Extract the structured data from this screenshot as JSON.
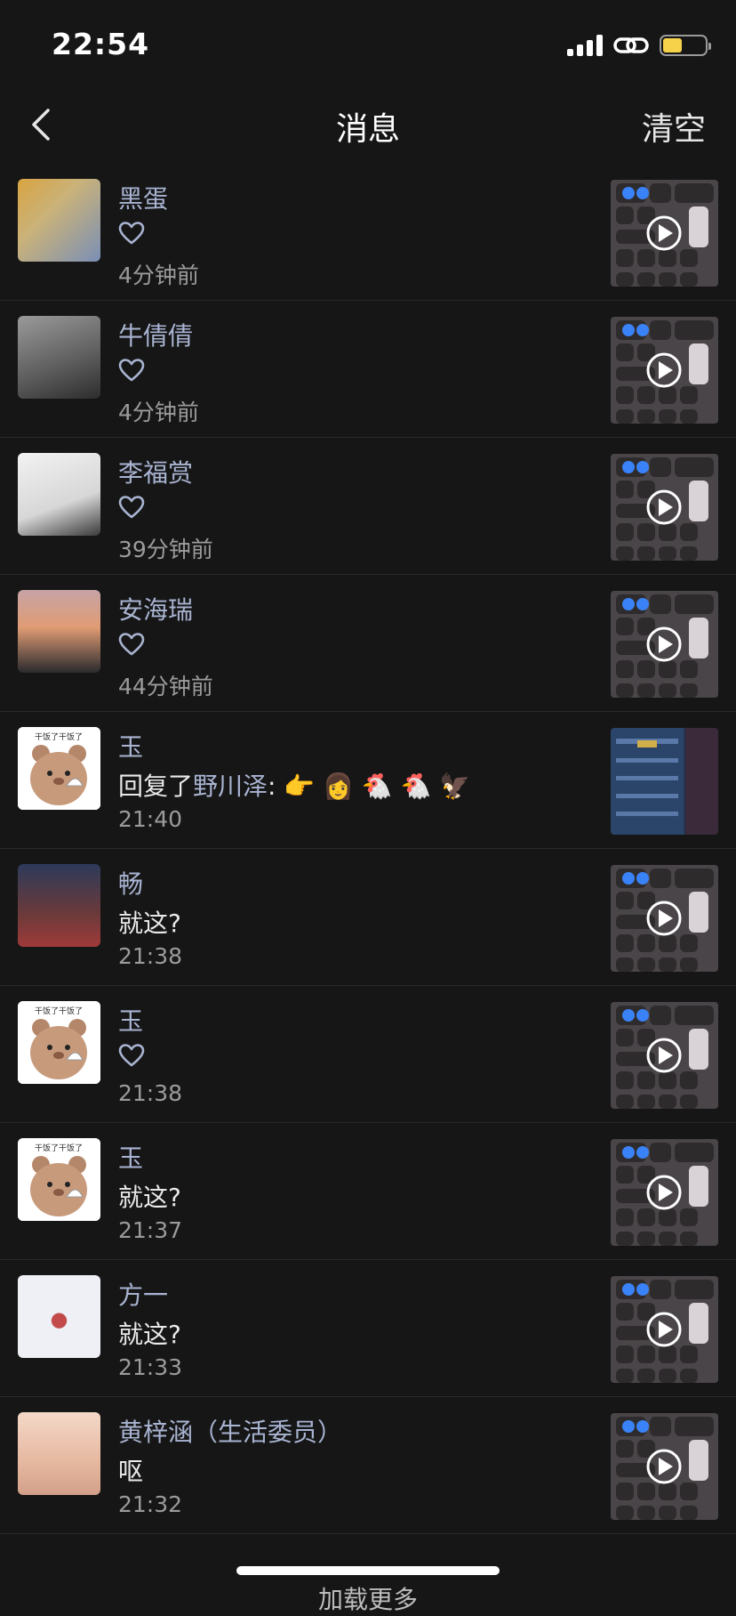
{
  "status": {
    "time": "22:54"
  },
  "nav": {
    "title": "消息",
    "clear_label": "清空"
  },
  "items": [
    {
      "name": "黑蛋",
      "type": "like",
      "content": "",
      "time": "4分钟前"
    },
    {
      "name": "牛倩倩",
      "type": "like",
      "content": "",
      "time": "4分钟前"
    },
    {
      "name": "李福赏",
      "type": "like",
      "content": "",
      "time": "39分钟前"
    },
    {
      "name": "安海瑞",
      "type": "like",
      "content": "",
      "time": "44分钟前"
    },
    {
      "name": "玉",
      "type": "reply",
      "content_prefix": "回复了",
      "content_mention": "野川泽",
      "content": ": 👉 👩 🐔 🐔 🦅",
      "time": "21:40"
    },
    {
      "name": "畅",
      "type": "comment",
      "content": "就这?",
      "time": "21:38"
    },
    {
      "name": "玉",
      "type": "like",
      "content": "",
      "time": "21:38"
    },
    {
      "name": "玉",
      "type": "comment",
      "content": "就这?",
      "time": "21:37"
    },
    {
      "name": "方一",
      "type": "comment",
      "content": "就这?",
      "time": "21:33"
    },
    {
      "name": "黄梓涵（生活委员）",
      "type": "comment",
      "content": "呕",
      "time": "21:32"
    }
  ],
  "footer": {
    "load_more": "加载更多"
  }
}
